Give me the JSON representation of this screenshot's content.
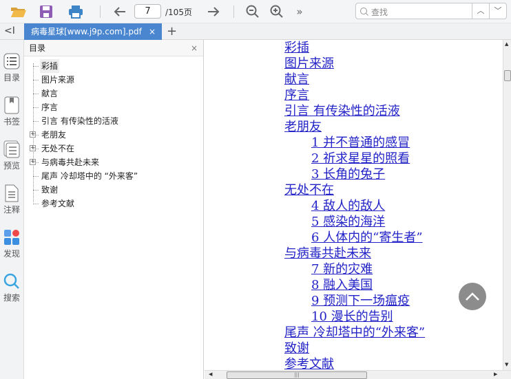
{
  "toolbar": {
    "page_current": "7",
    "page_total": "/105页",
    "search_placeholder": "查找",
    "more": "»"
  },
  "tabs": {
    "collapse": "<I",
    "doc": "病毒星球[www.j9p.com].pdf",
    "close": "×",
    "add": "+"
  },
  "rail": [
    {
      "label": "目录"
    },
    {
      "label": "书签"
    },
    {
      "label": "预览"
    },
    {
      "label": "注释"
    },
    {
      "label": "发现"
    },
    {
      "label": "搜索"
    }
  ],
  "panel": {
    "title": "目录",
    "close": "×",
    "items": [
      {
        "label": "彩插",
        "expandable": false
      },
      {
        "label": "图片来源",
        "expandable": false
      },
      {
        "label": "献言",
        "expandable": false
      },
      {
        "label": "序言",
        "expandable": false
      },
      {
        "label": "引言 有传染性的活液",
        "expandable": false
      },
      {
        "label": "老朋友",
        "expandable": true
      },
      {
        "label": "无处不在",
        "expandable": true
      },
      {
        "label": "与病毒共赴未来",
        "expandable": true
      },
      {
        "label": "尾声 冷却塔中的 “外来客”",
        "expandable": false
      },
      {
        "label": "致谢",
        "expandable": false
      },
      {
        "label": "参考文献",
        "expandable": false
      }
    ]
  },
  "content": {
    "links": [
      {
        "text": "彩插",
        "level": 0
      },
      {
        "text": "图片来源",
        "level": 0
      },
      {
        "text": "献言",
        "level": 0
      },
      {
        "text": "序言",
        "level": 0
      },
      {
        "text": "引言 有传染性的活液",
        "level": 0
      },
      {
        "text": "老朋友",
        "level": 0
      },
      {
        "text": "1 并不普通的感冒",
        "level": 1
      },
      {
        "text": "2 祈求星星的照看",
        "level": 1
      },
      {
        "text": "3 长角的兔子",
        "level": 1
      },
      {
        "text": "无处不在",
        "level": 0
      },
      {
        "text": "4 敌人的敌人",
        "level": 1
      },
      {
        "text": "5 感染的海洋",
        "level": 1
      },
      {
        "text": "6 人体内的“寄生者”",
        "level": 1
      },
      {
        "text": "与病毒共赴未来",
        "level": 0
      },
      {
        "text": "7 新的灾难",
        "level": 1
      },
      {
        "text": "8 融入美国",
        "level": 1
      },
      {
        "text": "9 预测下一场瘟疫",
        "level": 1
      },
      {
        "text": "10 漫长的告别",
        "level": 1
      },
      {
        "text": "尾声 冷却塔中的“外来客”",
        "level": 0
      },
      {
        "text": "致谢",
        "level": 0
      },
      {
        "text": "参考文献",
        "level": 0
      }
    ]
  }
}
